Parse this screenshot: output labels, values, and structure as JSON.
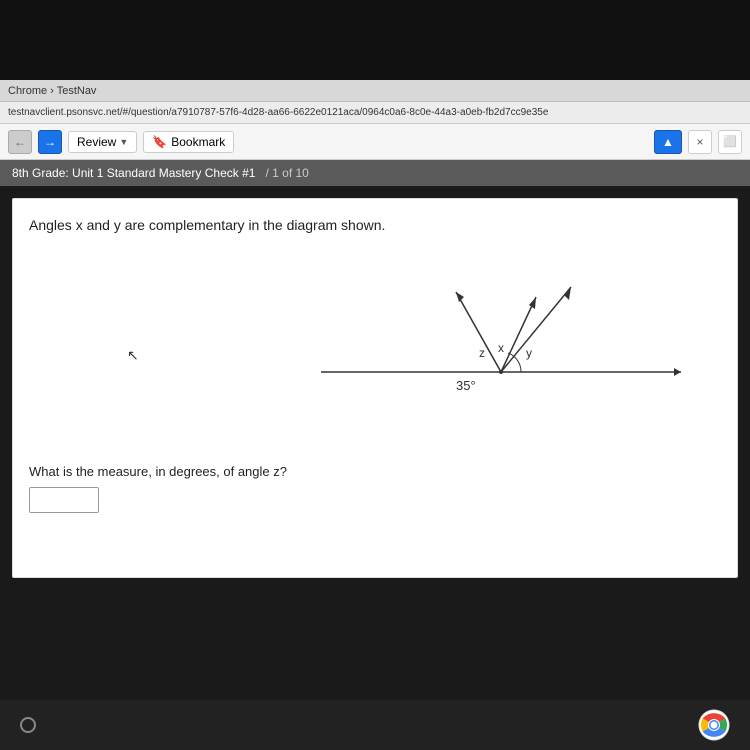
{
  "browser": {
    "tab_label": "Chrome › TestNav",
    "address": "testnavclient.psonsvc.net/#/question/a7910787-57f6-4d28-aa66-6622e0121aca/0964c0a6-8c0e-44a3-a0eb-fb2d7cc9e35e",
    "back_button": "‹",
    "forward_button": "›",
    "review_label": "Review",
    "bookmark_label": "Bookmark",
    "x_label": "×",
    "cursor_label": "▲"
  },
  "grade_bar": {
    "title": "8th Grade: Unit 1 Standard Mastery Check #1",
    "progress": "/ 1 of 10"
  },
  "question": {
    "text": "Angles x and y are complementary in the diagram shown.",
    "sub_question": "What is the measure, in degrees, of angle z?",
    "angle_label": "35°",
    "z_label": "z",
    "x_label": "x",
    "y_label": "y",
    "answer_placeholder": ""
  },
  "taskbar": {
    "chrome_icon_label": "Chrome"
  }
}
